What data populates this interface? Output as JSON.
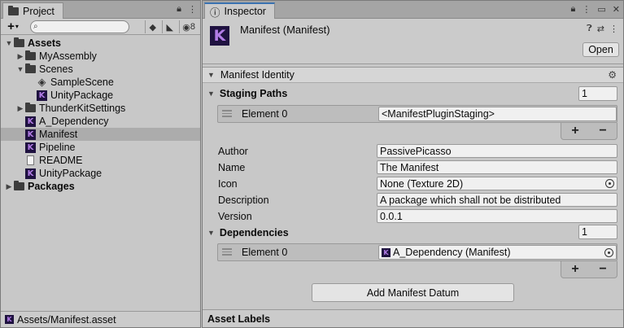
{
  "project": {
    "tab_label": "Project",
    "search_placeholder": "",
    "hidden_count": "8",
    "tree": {
      "assets": "Assets",
      "my_assembly": "MyAssembly",
      "scenes": "Scenes",
      "sample_scene": "SampleScene",
      "unity_package_scene": "UnityPackage",
      "thunderkit_settings": "ThunderKitSettings",
      "a_dependency": "A_Dependency",
      "manifest": "Manifest",
      "pipeline": "Pipeline",
      "readme": "README",
      "unity_package": "UnityPackage",
      "packages": "Packages"
    },
    "status_path": "Assets/Manifest.asset"
  },
  "inspector": {
    "tab_label": "Inspector",
    "title": "Manifest (Manifest)",
    "open_label": "Open",
    "section_title": "Manifest Identity",
    "staging_paths": {
      "label": "Staging Paths",
      "count": "1",
      "element_label": "Element 0",
      "element_value": "<ManifestPluginStaging>"
    },
    "fields": {
      "author_label": "Author",
      "author_value": "PassivePicasso",
      "name_label": "Name",
      "name_value": "The Manifest",
      "icon_label": "Icon",
      "icon_value": "None (Texture 2D)",
      "description_label": "Description",
      "description_value": "A package which shall not be distributed",
      "version_label": "Version",
      "version_value": "0.0.1"
    },
    "dependencies": {
      "label": "Dependencies",
      "count": "1",
      "element_label": "Element 0",
      "element_value": "A_Dependency (Manifest)"
    },
    "add_datum_label": "Add Manifest Datum",
    "asset_labels": "Asset Labels"
  },
  "icons": {
    "thunderkit_glyph": "K",
    "plus": "+",
    "minus": "−"
  }
}
